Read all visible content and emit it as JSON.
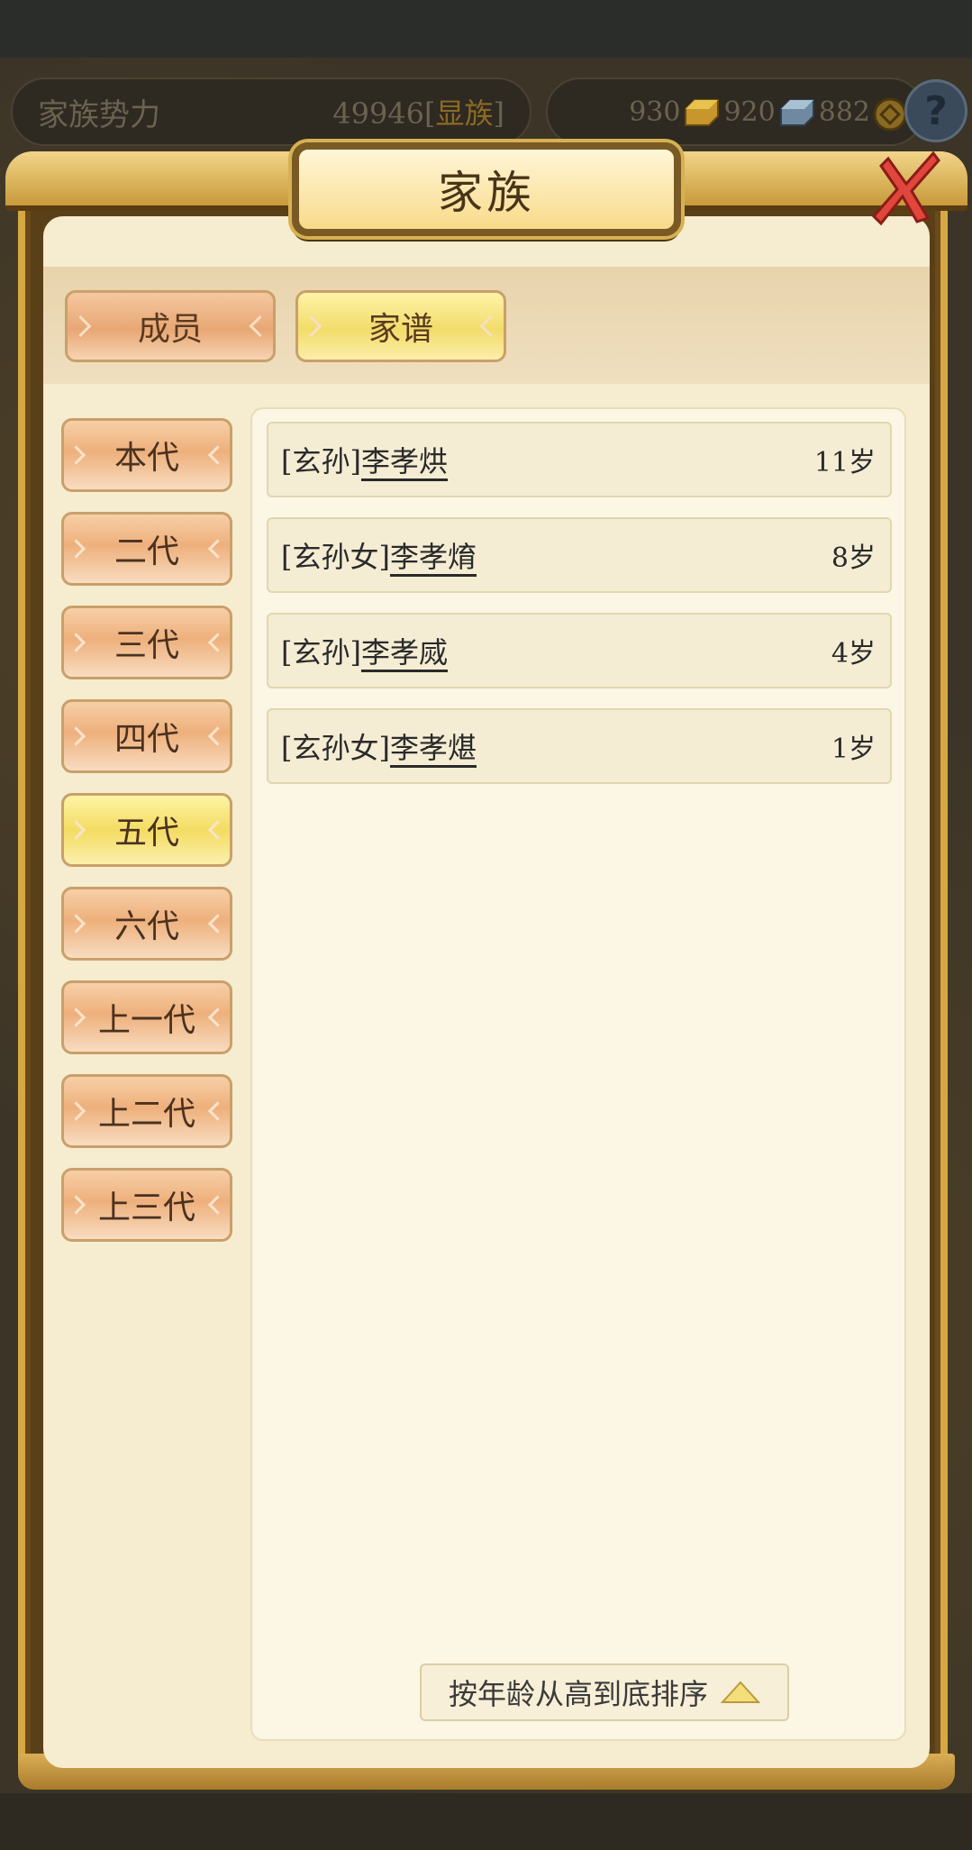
{
  "header": {
    "clan_power_label": "家族势力",
    "clan_power_value": "49946",
    "clan_power_rank_open": "[",
    "clan_power_rank": "显族",
    "clan_power_rank_close": "]",
    "resources": [
      {
        "value": "930",
        "icon": "gold-ingot-icon"
      },
      {
        "value": "920",
        "icon": "silver-ingot-icon"
      },
      {
        "value": "882",
        "icon": "copper-coin-icon"
      }
    ],
    "help_label": "?"
  },
  "dialog": {
    "title": "家族",
    "tabs": [
      {
        "label": "成员",
        "active": false
      },
      {
        "label": "家谱",
        "active": true
      }
    ]
  },
  "generations": [
    {
      "label": "本代",
      "active": false
    },
    {
      "label": "二代",
      "active": false
    },
    {
      "label": "三代",
      "active": false
    },
    {
      "label": "四代",
      "active": false
    },
    {
      "label": "五代",
      "active": true
    },
    {
      "label": "六代",
      "active": false
    },
    {
      "label": "上一代",
      "active": false
    },
    {
      "label": "上二代",
      "active": false
    },
    {
      "label": "上三代",
      "active": false
    }
  ],
  "members": [
    {
      "relation": "[玄孙]",
      "name": "李孝烘",
      "age": "11岁"
    },
    {
      "relation": "[玄孙女]",
      "name": "李孝焴",
      "age": "8岁"
    },
    {
      "relation": "[玄孙]",
      "name": "李孝烕",
      "age": "4岁"
    },
    {
      "relation": "[玄孙女]",
      "name": "李孝煁",
      "age": "1岁"
    }
  ],
  "sort_button": {
    "label": "按年龄从高到底排序",
    "icon": "triangle-up-icon"
  },
  "colors": {
    "active_tab": "#f3dc62",
    "inactive_tab": "#eeb07c",
    "panel_bg": "#fcf6e4",
    "frame_gold": "#d6a843",
    "close_red": "#e0463c"
  }
}
